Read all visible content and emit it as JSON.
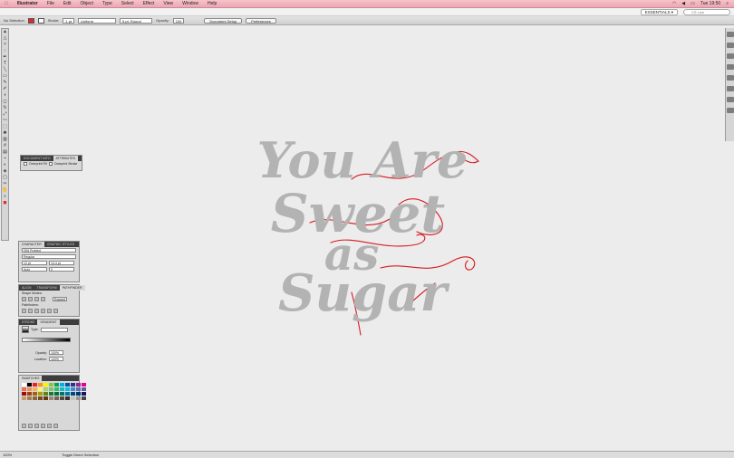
{
  "menubar": {
    "app": "Illustrator",
    "items": [
      "File",
      "Edit",
      "Object",
      "Type",
      "Select",
      "Effect",
      "View",
      "Window",
      "Help"
    ],
    "clock": "Tue 19:50",
    "menubar_color": "#f2b3bd"
  },
  "appbar": {
    "workspace": "ESSENTIALS ▾",
    "search": "CS Live"
  },
  "control": {
    "selection": "No Selection",
    "stroke_label": "Stroke:",
    "stroke_value": "1 pt",
    "brush": "Uniform",
    "profile": "5 pt. Round",
    "opacity_label": "Opacity:",
    "opacity_value": "100",
    "doc_setup": "Document Setup",
    "preferences": "Preferences",
    "fill_color": "#e8232a"
  },
  "attr_panel": {
    "tabs": [
      "DOCUMENT INFO",
      "ATTRIBUTES"
    ],
    "overprint_fill": "Overprint Fill",
    "overprint_stroke": "Overprint Stroke"
  },
  "char_panel": {
    "tabs": [
      "CHARACTER",
      "GRAPHIC STYLES"
    ],
    "font": "DIN Probect",
    "style": "Regular",
    "size": "12 pt",
    "leading": "14.4 pt",
    "tracking": "Auto",
    "kerning": "0"
  },
  "pathfinder_panel": {
    "tabs": [
      "ALIGN",
      "TRANSFORM",
      "PATHFINDER"
    ],
    "shape_modes": "Shape Modes:",
    "expand": "Expand",
    "pathfinders": "Pathfinders:"
  },
  "gradient_panel": {
    "tabs": [
      "STROKE",
      "GRADIENT"
    ],
    "type_label": "Type:",
    "opacity_label": "Opacity:",
    "location_label": "Location:",
    "opacity_value": "100%",
    "location_value": "100%"
  },
  "swatches_panel": {
    "tabs": [
      "SWATCHES"
    ],
    "colors": [
      "#ffffff",
      "#000000",
      "#e8232a",
      "#f7941d",
      "#fff200",
      "#8dc63f",
      "#00a651",
      "#00aeef",
      "#0054a6",
      "#2e3192",
      "#92278f",
      "#ec008c",
      "#f26c4f",
      "#f68e56",
      "#fbaf5d",
      "#fff568",
      "#acd372",
      "#7cc576",
      "#3bb878",
      "#1abbb4",
      "#00bff3",
      "#438ccb",
      "#5574b9",
      "#605ca8",
      "#9e0b0f",
      "#a0410d",
      "#a3620a",
      "#aba000",
      "#598527",
      "#197b30",
      "#007236",
      "#00746b",
      "#0076a3",
      "#004a80",
      "#003471",
      "#1b1464",
      "#c69c6d",
      "#a67c52",
      "#8c6239",
      "#754c24",
      "#603913",
      "#998675",
      "#736357",
      "#534741",
      "#362f2d",
      "#c2c2c2",
      "#959595",
      "#464646"
    ]
  },
  "artwork": {
    "lines": [
      "You Are",
      "Sweet",
      "as",
      "Sugar"
    ],
    "lettering_color": "#b3b3b3",
    "swash_color": "#d71920"
  },
  "status": {
    "zoom": "100%",
    "tool": "Toggle Direct Selection"
  },
  "icons": {
    "toolbox": [
      "selection-tool",
      "direct-selection-tool",
      "magic-wand-tool",
      "lasso-tool",
      "pen-tool",
      "type-tool",
      "line-tool",
      "rectangle-tool",
      "paintbrush-tool",
      "pencil-tool",
      "blob-brush-tool",
      "eraser-tool",
      "rotate-tool",
      "scale-tool",
      "warp-tool",
      "free-transform-tool",
      "symbol-sprayer-tool",
      "column-graph-tool",
      "mesh-tool",
      "gradient-tool",
      "eyedropper-tool",
      "blend-tool",
      "live-paint-tool",
      "artboard-tool",
      "slice-tool",
      "hand-tool",
      "zoom-tool",
      "fill-stroke-swatch"
    ]
  }
}
